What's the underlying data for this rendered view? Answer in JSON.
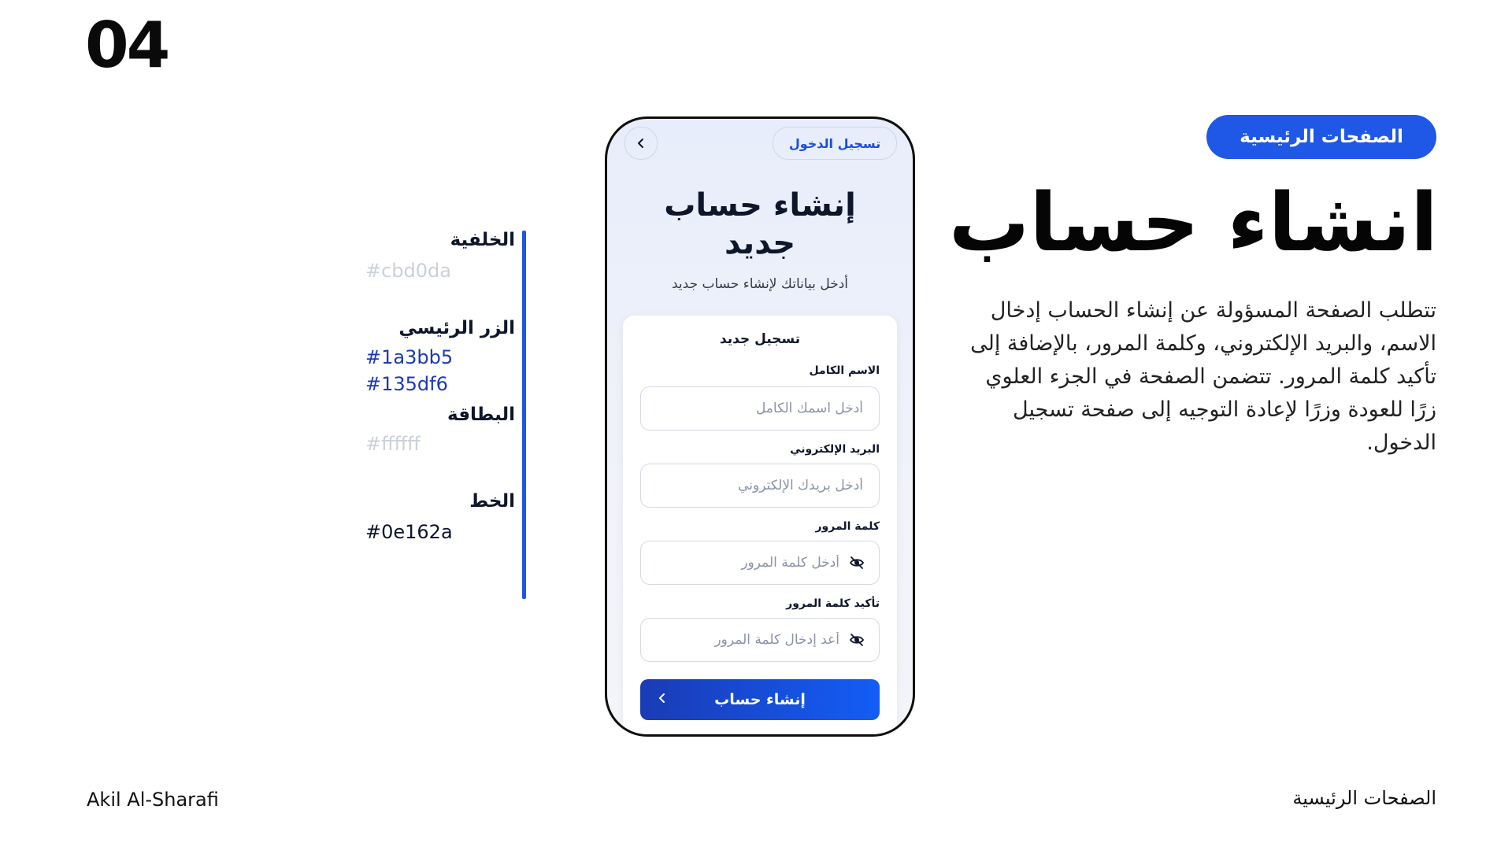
{
  "slide": {
    "number": "04",
    "author": "Akil Al-Sharafi",
    "section_footer": "الصفحات الرئيسية"
  },
  "intro": {
    "tag": "الصفحات الرئيسية",
    "title": "انشاء حساب",
    "description": "تتطلب الصفحة المسؤولة عن إنشاء الحساب إدخال الاسم، والبريد الإلكتروني، وكلمة المرور، بالإضافة إلى تأكيد كلمة المرور. تتضمن الصفحة في الجزء العلوي زرًا للعودة وزرًا لإعادة التوجيه إلى صفحة تسجيل الدخول."
  },
  "palette": [
    {
      "label": "الخلفية",
      "values": [
        "#cbd0da"
      ],
      "color": "#cbd0da"
    },
    {
      "label": "الزر الرئيسي",
      "values": [
        "#1a3bb5",
        "#135df6"
      ],
      "color": "#1a3bb5"
    },
    {
      "label": "البطاقة",
      "values": [
        "#ffffff"
      ],
      "color": "#cbd0da"
    },
    {
      "label": "الخط",
      "values": [
        "#0e162a"
      ],
      "color": "#0e162a"
    }
  ],
  "phone": {
    "back_icon": "chevron-left-icon",
    "login_link": "تسجيل الدخول",
    "title": "إنشاء حساب جديد",
    "subtitle": "أدخل بياناتك لإنشاء حساب جديد",
    "card": {
      "heading": "تسجيل جديد",
      "fields": [
        {
          "label": "الاسم الكامل",
          "placeholder": "أدخل اسمك الكامل",
          "value": "",
          "icon": ""
        },
        {
          "label": "البريد الإلكتروني",
          "placeholder": "أدخل بريدك الإلكتروني",
          "value": "",
          "icon": ""
        },
        {
          "label": "كلمة المرور",
          "placeholder": "أدخل كلمة المرور",
          "value": "",
          "icon": "eye-off-icon"
        },
        {
          "label": "تأكيد كلمة المرور",
          "placeholder": "أعد إدخال كلمة المرور",
          "value": "",
          "icon": "eye-off-icon"
        }
      ],
      "submit": "إنشاء حساب",
      "submit_icon": "chevron-left-icon"
    }
  }
}
